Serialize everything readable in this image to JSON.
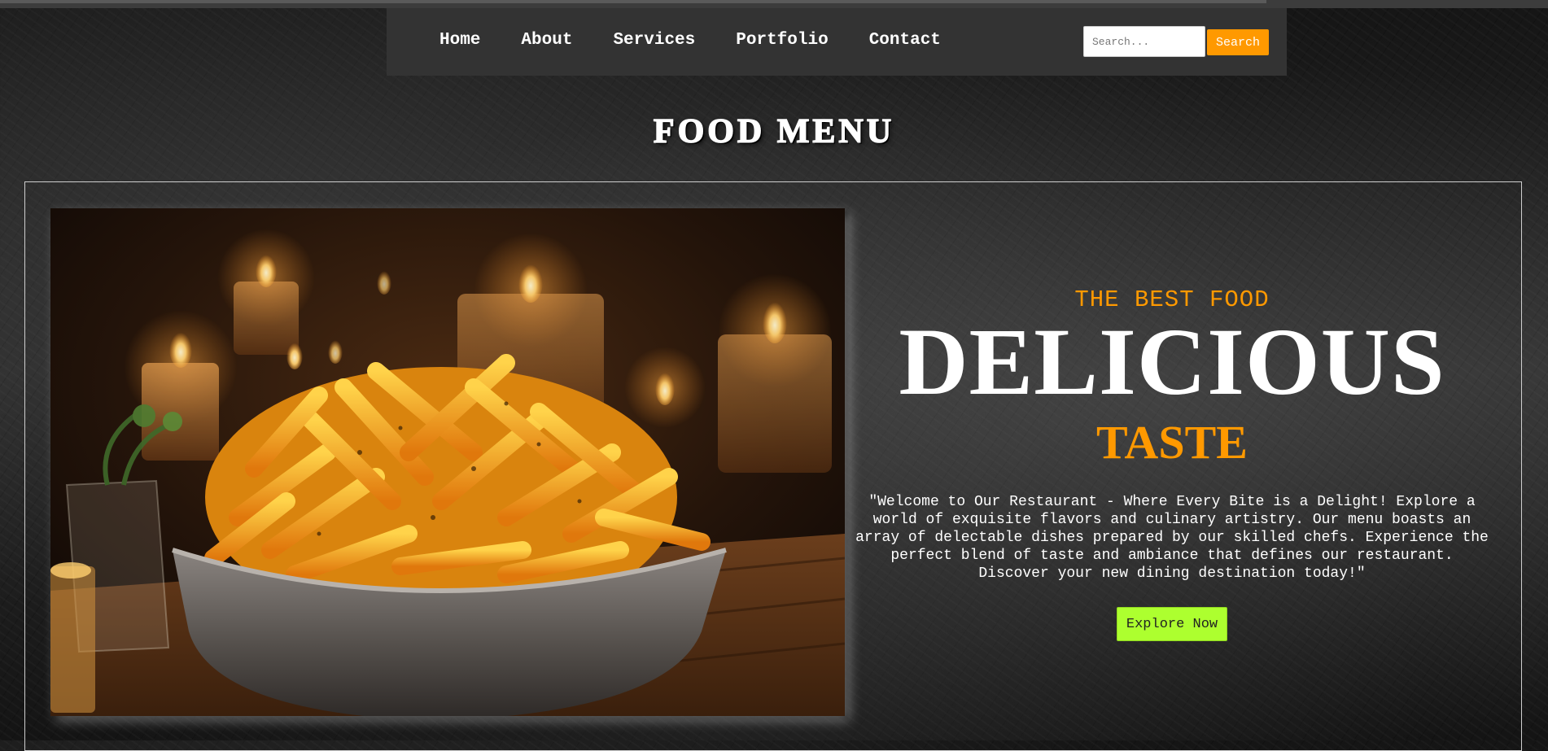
{
  "nav": {
    "links": [
      {
        "label": "Home"
      },
      {
        "label": "About"
      },
      {
        "label": "Services"
      },
      {
        "label": "Portfolio"
      },
      {
        "label": "Contact"
      }
    ],
    "search_placeholder": "Search...",
    "search_button": "Search"
  },
  "page": {
    "title": "FOOD MENU"
  },
  "hero": {
    "tagline": "THE BEST FOOD",
    "headline": "DELICIOUS",
    "subhead": "TASTE",
    "description": "\"Welcome to Our Restaurant - Where Every Bite is a Delight! Explore a world of exquisite flavors and culinary artistry. Our menu boasts an array of delectable dishes prepared by our skilled chefs. Experience the perfect blend of taste and ambiance that defines our restaurant. Discover your new dining destination today!\"",
    "button": "Explore Now"
  },
  "colors": {
    "accent": "#ff9900",
    "button_green": "#adff2f",
    "navbar": "#333333"
  }
}
